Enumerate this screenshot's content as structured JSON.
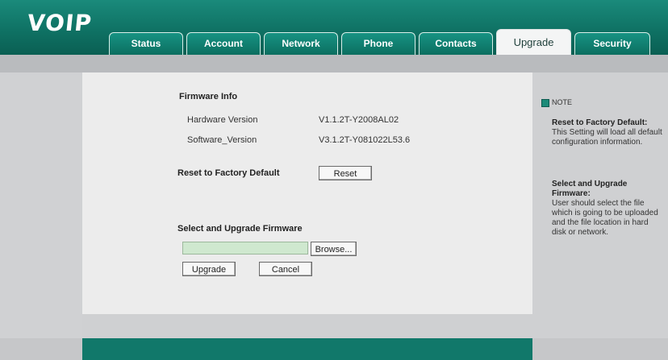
{
  "brand": {
    "logo_text": "VOIP"
  },
  "tabs": [
    {
      "label": "Status",
      "active": false
    },
    {
      "label": "Account",
      "active": false
    },
    {
      "label": "Network",
      "active": false
    },
    {
      "label": "Phone",
      "active": false
    },
    {
      "label": "Contacts",
      "active": false
    },
    {
      "label": "Upgrade",
      "active": true
    },
    {
      "label": "Security",
      "active": false
    }
  ],
  "firmware": {
    "section_title": "Firmware Info",
    "hardware_label": "Hardware Version",
    "hardware_value": "V1.1.2T-Y2008AL02",
    "software_label": "Software_Version",
    "software_value": "V3.1.2T-Y081022L53.6"
  },
  "reset": {
    "label": "Reset to Factory Default",
    "button": "Reset"
  },
  "upgrade": {
    "label": "Select and Upgrade Firmware",
    "file_value": "",
    "browse_button": "Browse...",
    "upgrade_button": "Upgrade",
    "cancel_button": "Cancel"
  },
  "note": {
    "title": "NOTE",
    "reset_heading": "Reset to Factory Default:",
    "reset_text": "This Setting will load all default configuration information.",
    "upgrade_heading": "Select and Upgrade Firmware:",
    "upgrade_text": "User should select the file which is going to be uploaded and the file location in hard disk or network."
  },
  "colors": {
    "brand": "#0f7264",
    "tab_active_bg": "#f4f5f5",
    "panel_bg": "#ececec",
    "input_bg": "#cfe8cf"
  }
}
